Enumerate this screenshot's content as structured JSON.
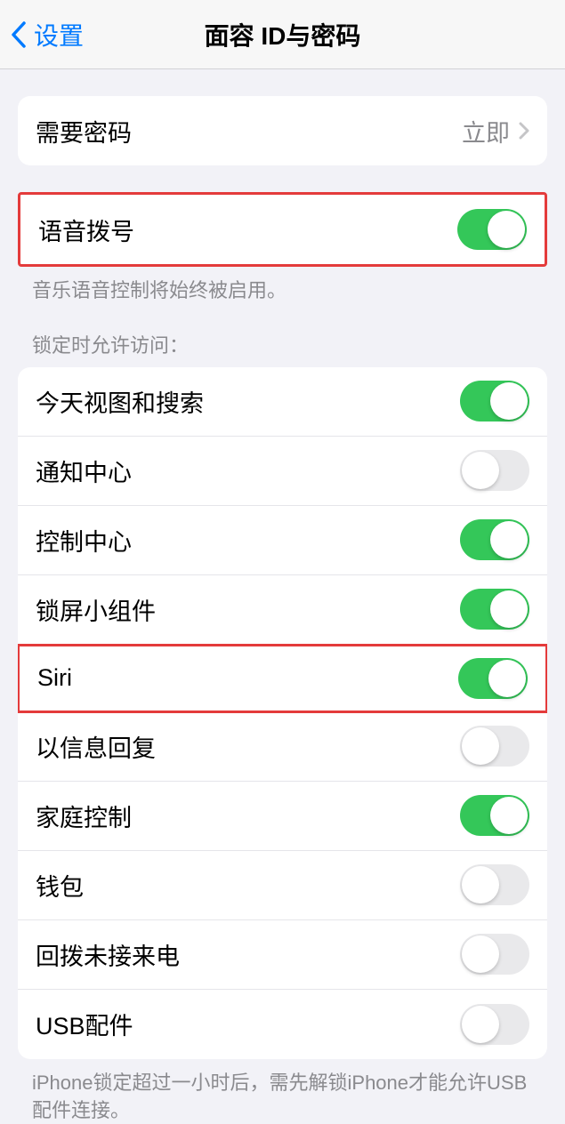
{
  "nav": {
    "back": "设置",
    "title": "面容 ID与密码"
  },
  "passcode": {
    "require_label": "需要密码",
    "require_value": "立即"
  },
  "voice_dial": {
    "label": "语音拨号",
    "on": true,
    "footer": "音乐语音控制将始终被启用。"
  },
  "locked_access": {
    "header": "锁定时允许访问：",
    "items": [
      {
        "label": "今天视图和搜索",
        "on": true
      },
      {
        "label": "通知中心",
        "on": false
      },
      {
        "label": "控制中心",
        "on": true
      },
      {
        "label": "锁屏小组件",
        "on": true
      },
      {
        "label": "Siri",
        "on": true
      },
      {
        "label": "以信息回复",
        "on": false
      },
      {
        "label": "家庭控制",
        "on": true
      },
      {
        "label": "钱包",
        "on": false
      },
      {
        "label": "回拨未接来电",
        "on": false
      },
      {
        "label": "USB配件",
        "on": false
      }
    ],
    "footer": "iPhone锁定超过一小时后，需先解锁iPhone才能允许USB配件连接。"
  }
}
